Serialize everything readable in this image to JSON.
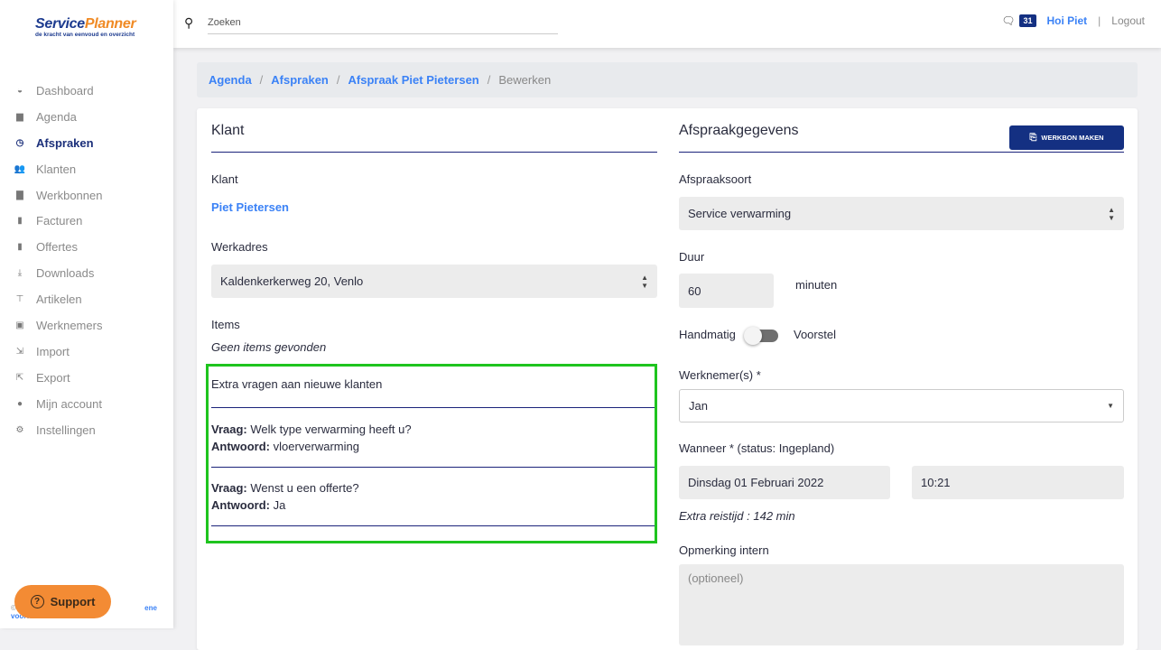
{
  "logo": {
    "part1": "Service",
    "part2": "Planner",
    "tagline": "de kracht van eenvoud en overzicht"
  },
  "sidebar": {
    "items": [
      {
        "label": "Dashboard",
        "icon": "tachometer-icon",
        "glyph": "◒"
      },
      {
        "label": "Agenda",
        "icon": "calendar-icon",
        "glyph": "▆"
      },
      {
        "label": "Afspraken",
        "icon": "clock-icon",
        "glyph": "◷",
        "active": true
      },
      {
        "label": "Klanten",
        "icon": "users-icon",
        "glyph": "👥"
      },
      {
        "label": "Werkbonnen",
        "icon": "briefcase-icon",
        "glyph": "▇"
      },
      {
        "label": "Facturen",
        "icon": "invoice-icon",
        "glyph": "▮"
      },
      {
        "label": "Offertes",
        "icon": "quote-icon",
        "glyph": "▮"
      },
      {
        "label": "Downloads",
        "icon": "download-icon",
        "glyph": "⤓"
      },
      {
        "label": "Artikelen",
        "icon": "paint-roller-icon",
        "glyph": "⊤"
      },
      {
        "label": "Werknemers",
        "icon": "id-badge-icon",
        "glyph": "▣"
      },
      {
        "label": "Import",
        "icon": "file-import-icon",
        "glyph": "⇲"
      },
      {
        "label": "Export",
        "icon": "file-export-icon",
        "glyph": "⇱"
      },
      {
        "label": "Mijn account",
        "icon": "user-icon",
        "glyph": "●"
      },
      {
        "label": "Instellingen",
        "icon": "gear-icon",
        "glyph": "⚙"
      }
    ],
    "footer": {
      "copyright": "©",
      "link": "ene voorwaarden"
    }
  },
  "support": {
    "label": "Support"
  },
  "topbar": {
    "search_placeholder": "Zoeken",
    "messages_count": "31",
    "greeting": "Hoi Piet",
    "separator": "|",
    "logout": "Logout"
  },
  "breadcrumb": {
    "items": [
      "Agenda",
      "Afspraken",
      "Afspraak Piet Pietersen"
    ],
    "current": "Bewerken"
  },
  "left": {
    "title": "Klant",
    "klant_label": "Klant",
    "klant_value": "Piet Pietersen",
    "werkadres_label": "Werkadres",
    "werkadres_value": "Kaldenkerkerweg 20, Venlo",
    "items_label": "Items",
    "items_empty": "Geen items gevonden",
    "extra_title": "Extra vragen aan nieuwe klanten",
    "qa": [
      {
        "q_label": "Vraag:",
        "q": "Welk type verwarming heeft u?",
        "a_label": "Antwoord:",
        "a": "vloerverwarming"
      },
      {
        "q_label": "Vraag:",
        "q": "Wenst u een offerte?",
        "a_label": "Antwoord:",
        "a": "Ja"
      }
    ]
  },
  "right": {
    "title": "Afspraakgegevens",
    "button": "WERKBON MAKEN",
    "soort_label": "Afspraaksoort",
    "soort_value": "Service verwarming",
    "duur_label": "Duur",
    "duur_value": "60",
    "duur_unit": "minuten",
    "toggle_left": "Handmatig",
    "toggle_right": "Voorstel",
    "toggle_on": false,
    "werknemer_label": "Werknemer(s) *",
    "werknemer_value": "Jan",
    "wanneer_label": "Wanneer * (status: Ingepland)",
    "date_value": "Dinsdag 01 Februari 2022",
    "time_value": "10:21",
    "reistijd": "Extra reistijd : 142 min",
    "opmerking_label": "Opmerking intern",
    "opmerking_placeholder": "(optioneel)"
  }
}
